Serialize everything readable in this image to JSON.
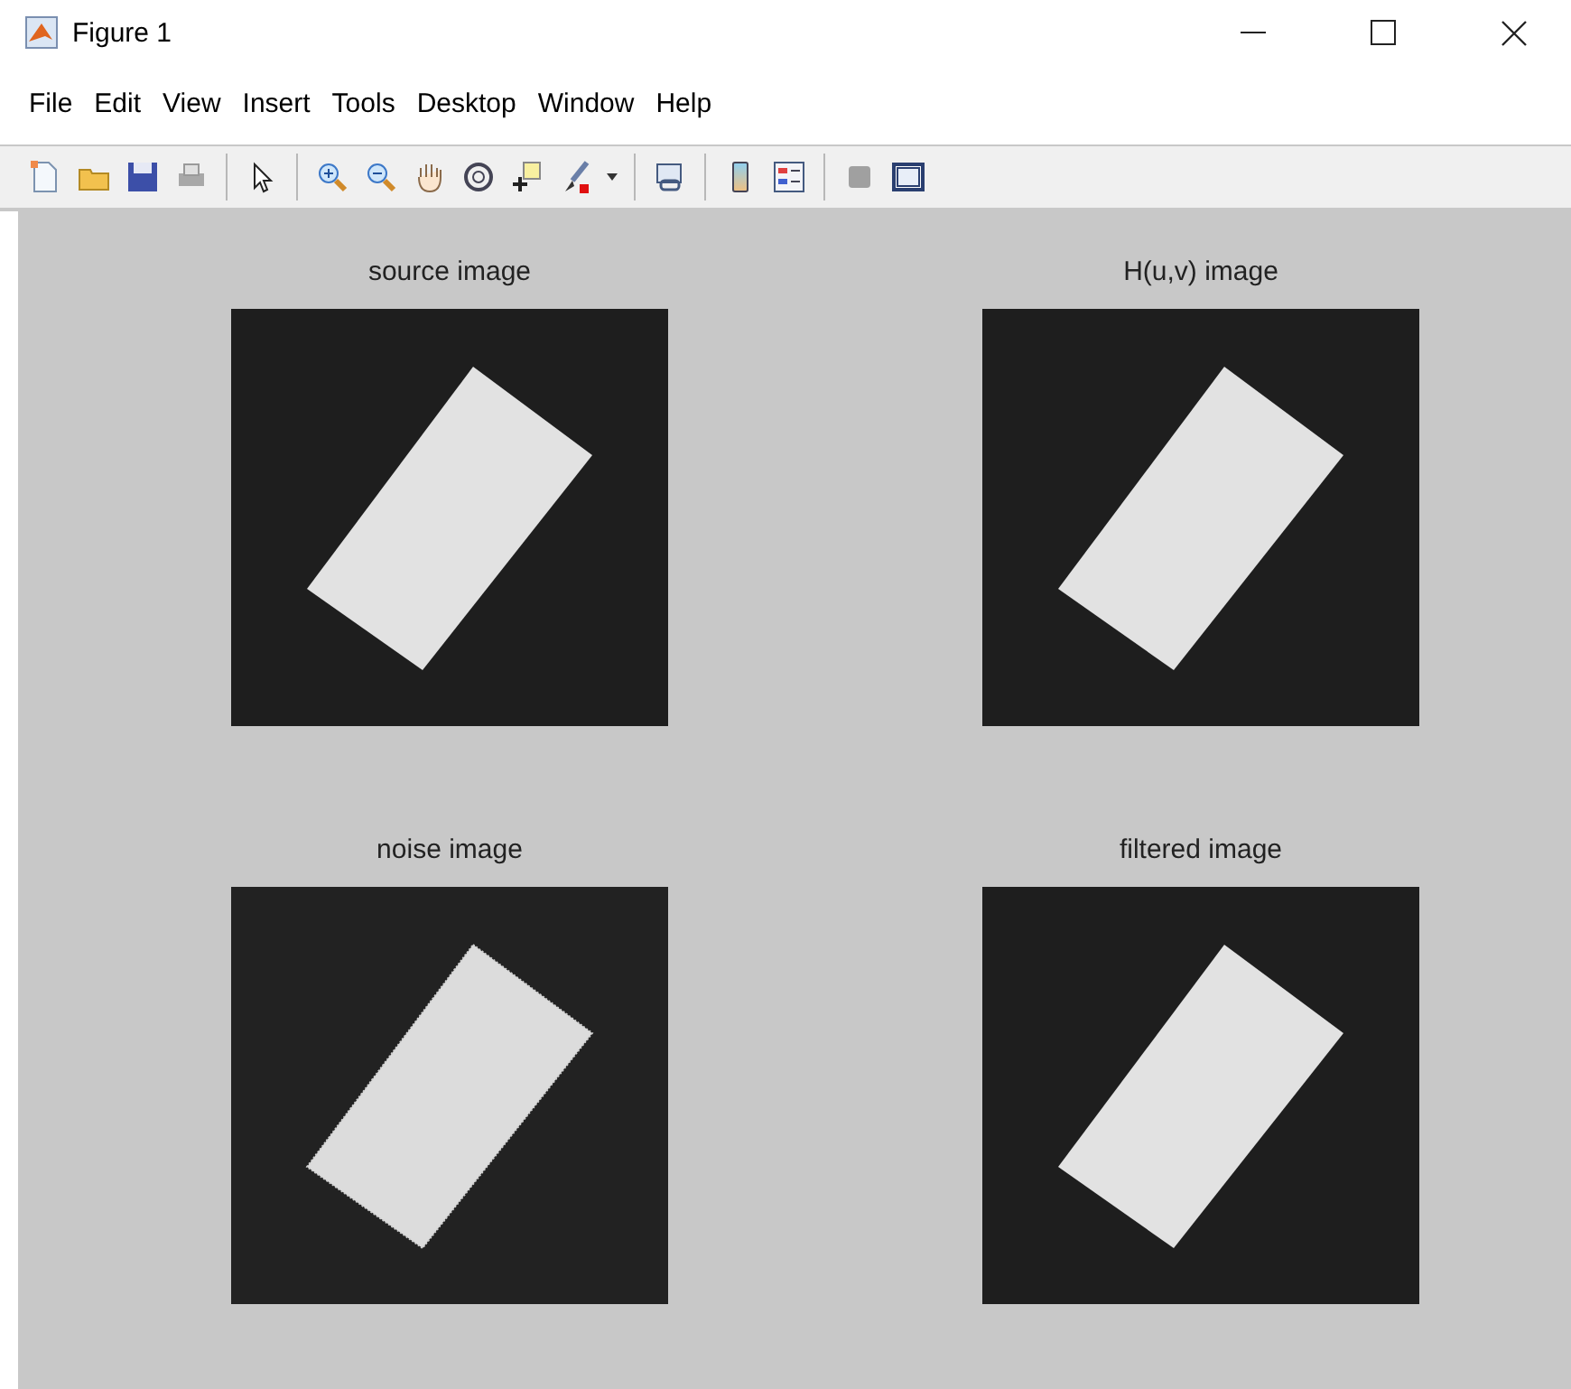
{
  "window": {
    "title": "Figure 1"
  },
  "menu": [
    "File",
    "Edit",
    "View",
    "Insert",
    "Tools",
    "Desktop",
    "Window",
    "Help"
  ],
  "subplots": [
    {
      "title": "source image",
      "kind": "clean"
    },
    {
      "title": "H(u,v) image",
      "kind": "clean"
    },
    {
      "title": "noise image",
      "kind": "noisy"
    },
    {
      "title": "filtered image",
      "kind": "clean"
    }
  ]
}
